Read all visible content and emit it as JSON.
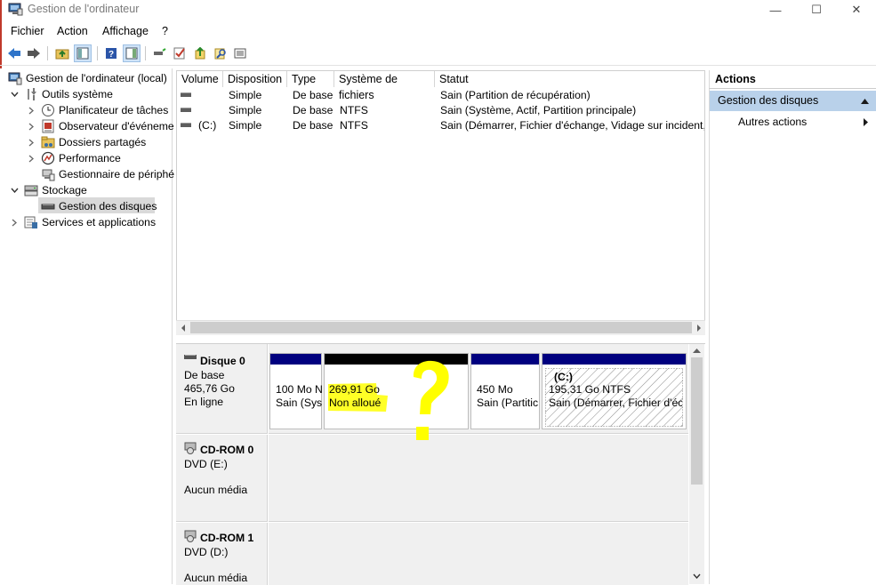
{
  "window": {
    "title": "Gestion de l'ordinateur",
    "controls": [
      "—",
      "☐",
      "✕"
    ]
  },
  "menu": [
    "Fichier",
    "Action",
    "Affichage",
    "?"
  ],
  "tree": {
    "root": "Gestion de l'ordinateur (local)",
    "outils": "Outils système",
    "planificateur": "Planificateur de tâches",
    "observateur": "Observateur d'événeme",
    "dossiers": "Dossiers partagés",
    "performance": "Performance",
    "gestionnaire": "Gestionnaire de périphé",
    "stockage": "Stockage",
    "gestion_disques": "Gestion des disques",
    "services": "Services et applications"
  },
  "volumes": {
    "columns": [
      "Volume",
      "Disposition",
      "Type",
      "Système de fichiers",
      "Statut"
    ],
    "rows": [
      {
        "volume": "",
        "disposition": "Simple",
        "type": "De base",
        "fs": "",
        "statut": "Sain (Partition de récupération)"
      },
      {
        "volume": "",
        "disposition": "Simple",
        "type": "De base",
        "fs": "NTFS",
        "statut": "Sain (Système, Actif, Partition principale)"
      },
      {
        "volume": "(C:)",
        "disposition": "Simple",
        "type": "De base",
        "fs": "NTFS",
        "statut": "Sain (Démarrer, Fichier d'échange, Vidage sur incident, P"
      }
    ]
  },
  "disks": {
    "disk0": {
      "name": "Disque 0",
      "type": "De base",
      "size": "465,76 Go",
      "state": "En ligne",
      "partitions": [
        {
          "line1": "100 Mo N",
          "line2": "Sain (Sys"
        },
        {
          "line1": "269,91 Go",
          "line2": "Non alloué"
        },
        {
          "line1": "450 Mo",
          "line2": "Sain (Partitic"
        },
        {
          "line0": "(C:)",
          "line1": "195,31 Go NTFS",
          "line2": "Sain (Démarrer, Fichier d'éc"
        }
      ]
    },
    "cdrom0": {
      "name": "CD-ROM 0",
      "drive": "DVD (E:)",
      "media": "Aucun média"
    },
    "cdrom1": {
      "name": "CD-ROM 1",
      "drive": "DVD (D:)",
      "media": "Aucun média"
    }
  },
  "annotation": {
    "mark": "?"
  },
  "actions": {
    "header": "Actions",
    "section": "Gestion des disques",
    "item": "Autres actions"
  },
  "colors": {
    "primary_partition": "#00007f",
    "unallocated": "#000000",
    "selection": "#b9d1ea",
    "highlighter": "#ffff00"
  }
}
